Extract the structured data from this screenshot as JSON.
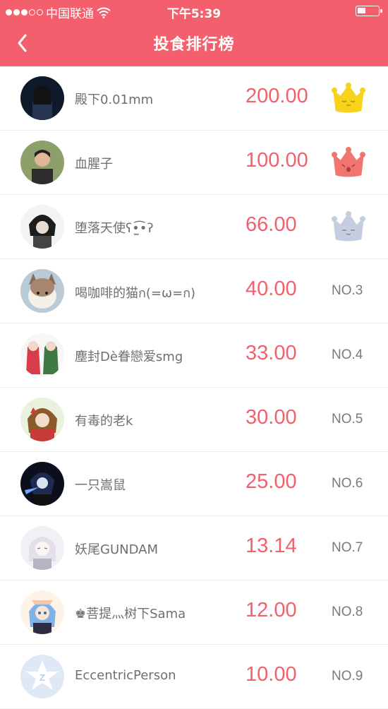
{
  "status_bar": {
    "carrier": "中国联通",
    "time": "下午5:39"
  },
  "header": {
    "title": "投食排行榜"
  },
  "colors": {
    "accent": "#f35f6c",
    "amount": "#f1616b",
    "crown_gold": "#f7d31c",
    "crown_pink": "#f0756f",
    "crown_silver": "#c6cde0"
  },
  "leaderboard": [
    {
      "name": "殿下0.01mm",
      "amount": "200.00",
      "rank": "",
      "crown": "gold-crown-icon"
    },
    {
      "name": "血腥子",
      "amount": "100.00",
      "rank": "",
      "crown": "pink-crown-icon"
    },
    {
      "name": "堕落天使ʕ•̫͡•ʔ",
      "amount": "66.00",
      "rank": "",
      "crown": "silver-crown-icon"
    },
    {
      "name": "喝咖啡的猫ก(=ω=ก)",
      "amount": "40.00",
      "rank": "NO.3"
    },
    {
      "name": "塵封Dè眷戀爱smg",
      "amount": "33.00",
      "rank": "NO.4"
    },
    {
      "name": "有毒的老k",
      "amount": "30.00",
      "rank": "NO.5"
    },
    {
      "name": "一只嵩鼠",
      "amount": "25.00",
      "rank": "NO.6"
    },
    {
      "name": "妖尾GUNDAM",
      "amount": "13.14",
      "rank": "NO.7"
    },
    {
      "name": "♚菩提灬树下Sama",
      "amount": "12.00",
      "rank": "NO.8"
    },
    {
      "name": "EccentricPerson",
      "amount": "10.00",
      "rank": "NO.9"
    }
  ]
}
